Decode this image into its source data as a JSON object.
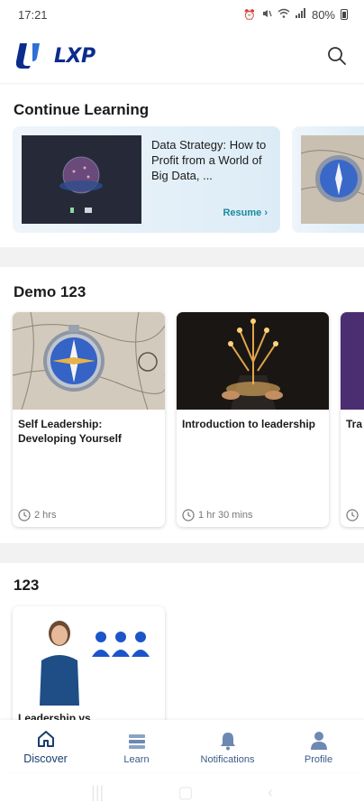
{
  "status_bar": {
    "time": "17:21",
    "battery": "80%",
    "icons": [
      "alarm-icon",
      "mute-icon",
      "wifi-icon",
      "signal-icon",
      "battery-icon"
    ]
  },
  "header": {
    "logo_text": "LXP",
    "search_icon": "search-icon"
  },
  "continue_learning": {
    "title": "Continue Learning",
    "cards": [
      {
        "title": "Data Strategy: How to Profit from a World of Big Data, ...",
        "action": "Resume ›"
      }
    ]
  },
  "demo_section": {
    "title": "Demo 123",
    "courses": [
      {
        "title": "Self Leadership: Developing Yourself",
        "duration": "2 hrs"
      },
      {
        "title": "Introduction to leadership",
        "duration": "1 hr 30 mins"
      },
      {
        "title": "Tra",
        "duration": ""
      }
    ]
  },
  "section_123": {
    "title": "123",
    "courses": [
      {
        "title": "Leadership vs"
      }
    ]
  },
  "bottom_nav": {
    "items": [
      {
        "label": "Discover",
        "icon": "home-icon",
        "active": true
      },
      {
        "label": "Learn",
        "icon": "books-icon",
        "active": false
      },
      {
        "label": "Notifications",
        "icon": "bell-icon",
        "active": false
      },
      {
        "label": "Profile",
        "icon": "person-icon",
        "active": false
      }
    ]
  },
  "colors": {
    "brand_blue": "#0b2c8c",
    "nav_blue": "#1a3d6e",
    "resume_teal": "#1b8aa0",
    "section_divider": "#f2f2f3"
  }
}
